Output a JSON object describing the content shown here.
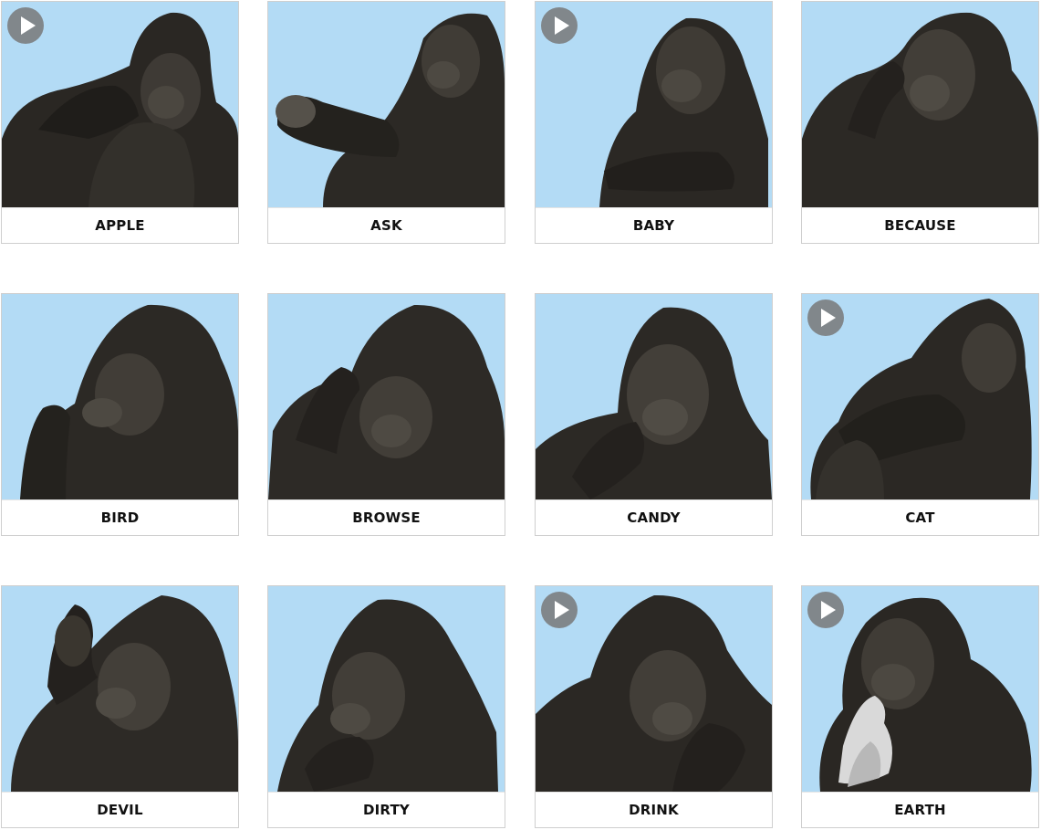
{
  "signs": [
    {
      "label": "APPLE",
      "has_video": true,
      "icon": "gorilla-photo",
      "play_icon": "play-icon"
    },
    {
      "label": "ASK",
      "has_video": false,
      "icon": "gorilla-photo",
      "play_icon": "play-icon"
    },
    {
      "label": "BABY",
      "has_video": true,
      "icon": "gorilla-photo",
      "play_icon": "play-icon"
    },
    {
      "label": "BECAUSE",
      "has_video": false,
      "icon": "gorilla-photo",
      "play_icon": "play-icon"
    },
    {
      "label": "BIRD",
      "has_video": false,
      "icon": "gorilla-photo",
      "play_icon": "play-icon"
    },
    {
      "label": "BROWSE",
      "has_video": false,
      "icon": "gorilla-photo",
      "play_icon": "play-icon"
    },
    {
      "label": "CANDY",
      "has_video": false,
      "icon": "gorilla-photo",
      "play_icon": "play-icon"
    },
    {
      "label": "CAT",
      "has_video": true,
      "icon": "gorilla-photo",
      "play_icon": "play-icon"
    },
    {
      "label": "DEVIL",
      "has_video": false,
      "icon": "gorilla-photo",
      "play_icon": "play-icon"
    },
    {
      "label": "DIRTY",
      "has_video": false,
      "icon": "gorilla-photo",
      "play_icon": "play-icon"
    },
    {
      "label": "DRINK",
      "has_video": true,
      "icon": "gorilla-photo",
      "play_icon": "play-icon"
    },
    {
      "label": "EARTH",
      "has_video": true,
      "icon": "gorilla-photo",
      "play_icon": "play-icon"
    }
  ],
  "colors": {
    "photo_background": "#b3dbf5",
    "fur_dark": "#26231f",
    "fur_mid": "#3a3631",
    "face": "#4a4741",
    "play_button": "#787878"
  }
}
